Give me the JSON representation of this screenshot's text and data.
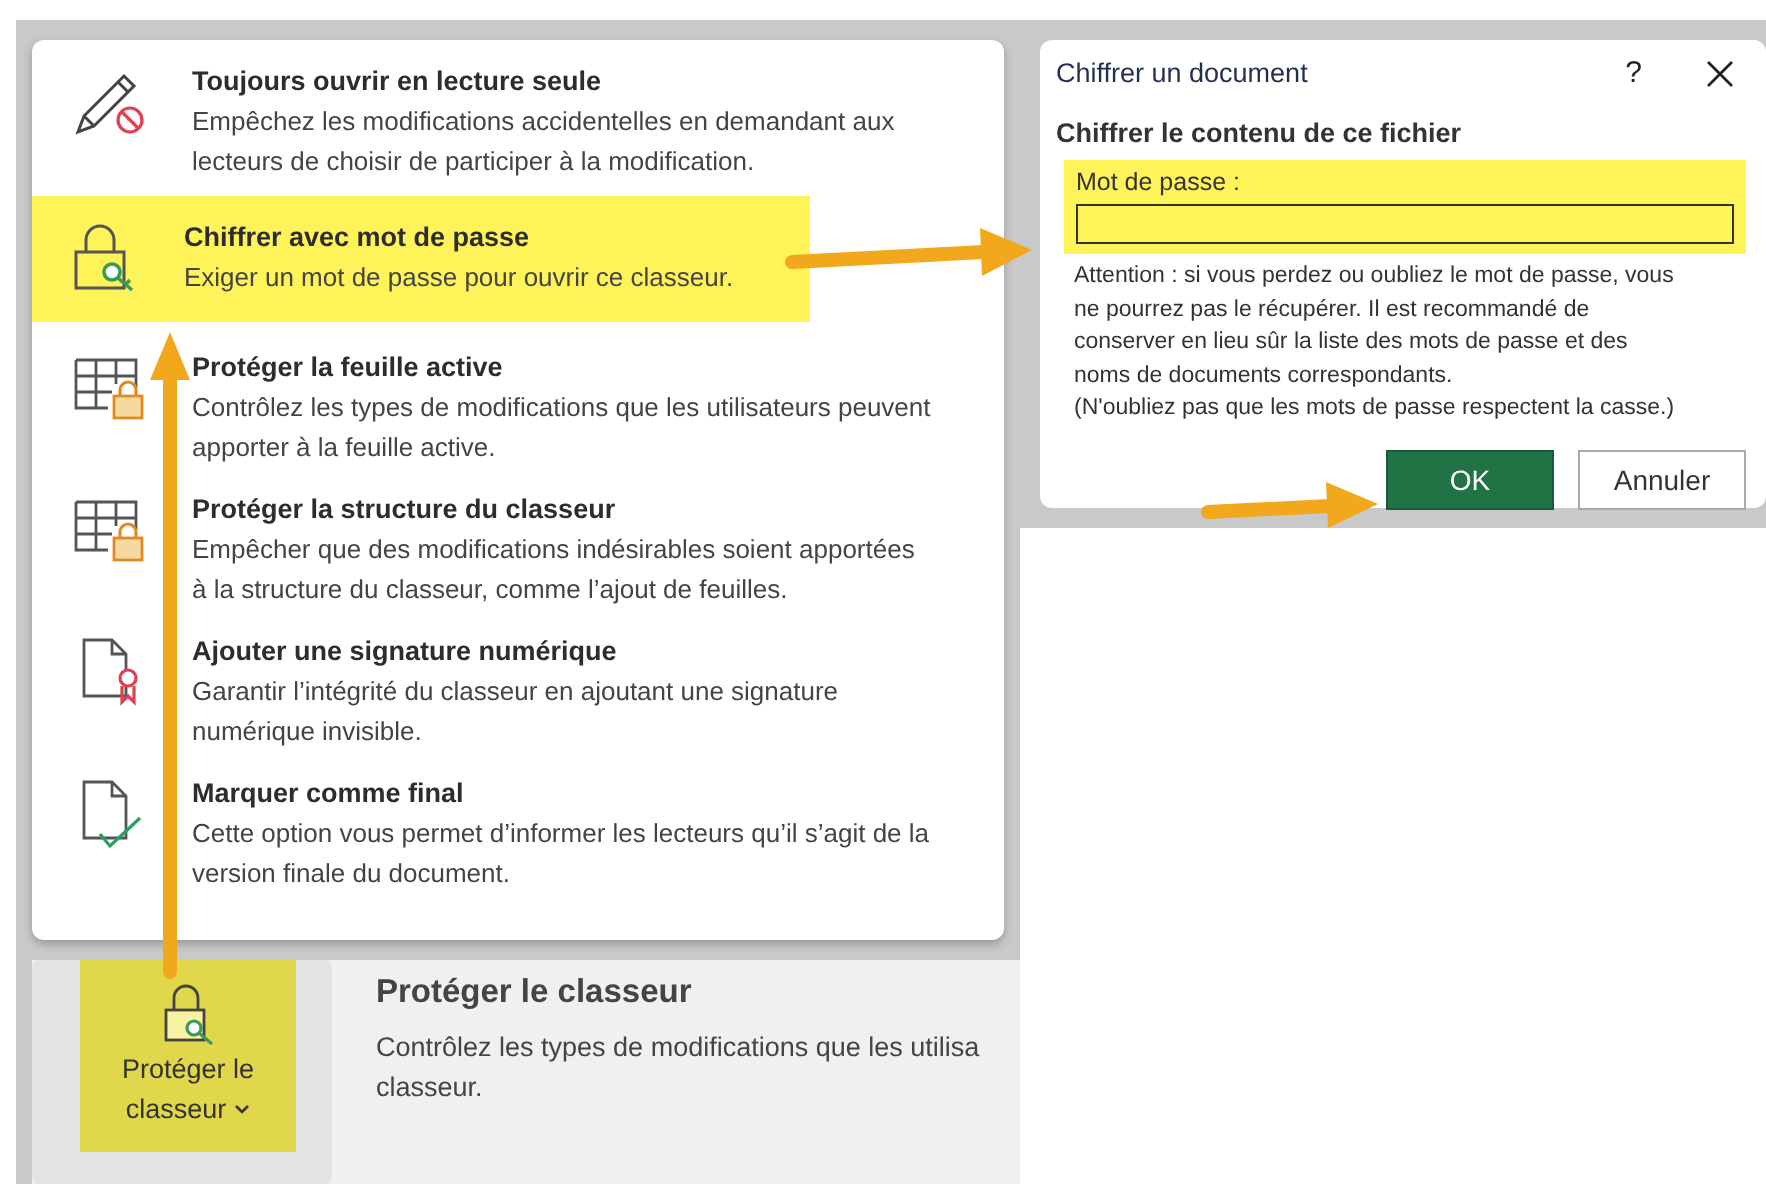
{
  "menu": {
    "items": [
      {
        "title": "Toujours ouvrir en lecture seule",
        "description": "Empêchez les modifications accidentelles en demandant aux lecteurs de choisir de participer à la modification.",
        "selected": false
      },
      {
        "title": "Chiffrer avec mot de passe",
        "description": "Exiger un mot de passe pour ouvrir ce classeur.",
        "selected": true
      },
      {
        "title": "Protéger la feuille active",
        "description": "Contrôlez les types de modifications que les utilisateurs peuvent apporter à la feuille active.",
        "selected": false
      },
      {
        "title": "Protéger la structure du classeur",
        "description": "Empêcher que des modifications indésirables soient apportées à la structure du classeur, comme l’ajout de feuilles.",
        "selected": false
      },
      {
        "title": "Ajouter une signature numérique",
        "description": "Garantir l’intégrité du classeur en ajoutant une signature numérique invisible.",
        "selected": false
      },
      {
        "title": "Marquer comme final",
        "description": "Cette option vous permet d’informer les lecteurs qu’il s’agit de la version finale du document.",
        "selected": false
      }
    ]
  },
  "ribbon": {
    "button": {
      "label": "Protéger le classeur",
      "highlighted": true
    },
    "section_title": "Protéger le classeur",
    "section_description_lines": [
      "Contrôlez les types de modifications que les utilisa",
      "classeur."
    ]
  },
  "dialog": {
    "title": "Chiffrer un document",
    "help": "?",
    "heading": "Chiffrer le contenu de ce fichier",
    "field": {
      "label": "Mot de passe :",
      "highlighted": true
    },
    "warning": "Attention : si vous perdez ou oubliez le mot de passe, vous ne pourrez pas le récupérer. Il est recommandé de conserver en lieu sûr la liste des mots de passe et des noms de documents correspondants.",
    "note": "(N'oubliez pas que les mots de passe respectent la casse.)",
    "buttons": [
      {
        "label": "OK",
        "kind": "primary"
      },
      {
        "label": "Annuler",
        "kind": "secondary"
      }
    ]
  }
}
